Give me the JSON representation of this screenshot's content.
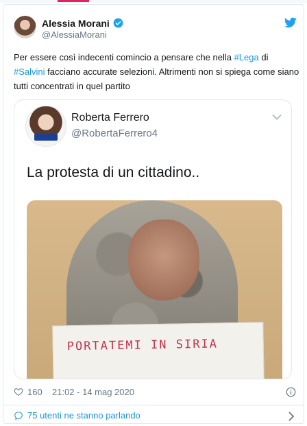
{
  "author": {
    "name": "Alessia Morani",
    "handle": "@AlessiaMorani"
  },
  "tweet": {
    "text_1": "Per essere così indecenti comincio a pensare che nella ",
    "tag_lega": "#Lega",
    "text_2": " di",
    "tag_salvini": "#Salvini",
    "text_3": " facciano accurate selezioni. Altrimenti non si spiega come siano tutti concentrati in quel partito"
  },
  "quoted": {
    "name": "Roberta Ferrero",
    "handle": "@RobertaFerrero4",
    "text": "La protesta di un cittadino..",
    "photo_sign_text": "PORTATEMI IN SIRIA"
  },
  "footer": {
    "likes": "160",
    "timestamp": "21:02 - 14 mag 2020",
    "talking": "75 utenti ne stanno parlando"
  },
  "colors": {
    "link": "#1b95e0",
    "text": "#14171a",
    "muted": "#657786",
    "border": "#e1e8ed"
  },
  "icons": [
    "verified-badge-icon",
    "twitter-bird-icon",
    "chevron-down-icon",
    "heart-icon",
    "info-icon",
    "speech-bubble-icon",
    "chevron-right-icon"
  ]
}
